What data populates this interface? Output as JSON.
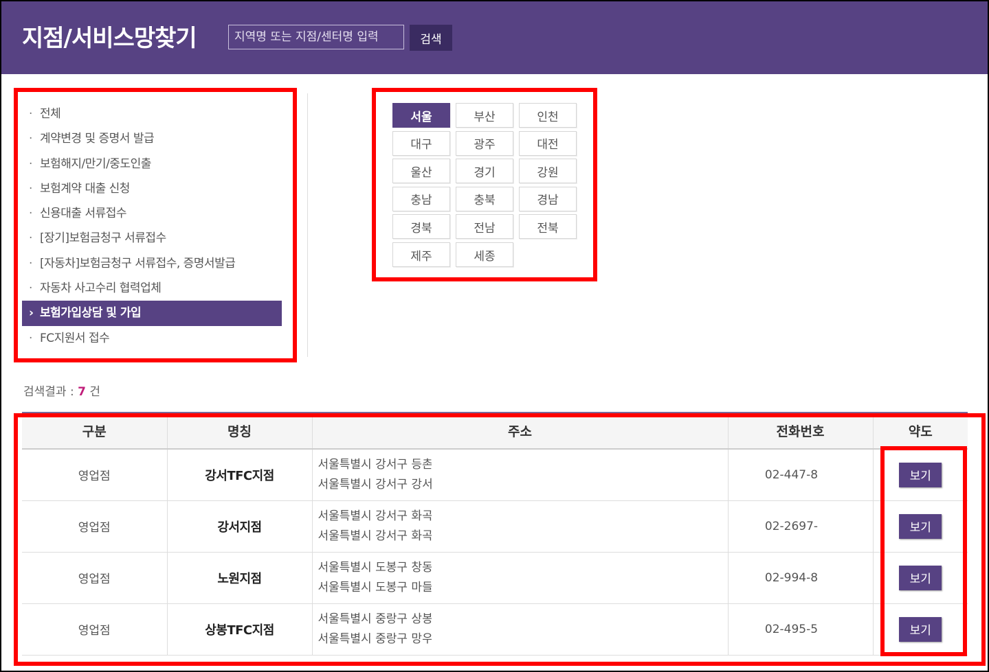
{
  "header": {
    "title": "지점/서비스망찾기",
    "search_placeholder": "지역명 또는 지점/센터명 입력",
    "search_button": "검색"
  },
  "categories": [
    {
      "label": "전체",
      "active": false
    },
    {
      "label": "계약변경 및 증명서 발급",
      "active": false
    },
    {
      "label": "보험해지/만기/중도인출",
      "active": false
    },
    {
      "label": "보험계약 대출 신청",
      "active": false
    },
    {
      "label": "신용대출 서류접수",
      "active": false
    },
    {
      "label": "[장기]보험금청구 서류접수",
      "active": false
    },
    {
      "label": "[자동차]보험금청구 서류접수, 증명서발급",
      "active": false
    },
    {
      "label": "자동차 사고수리 협력업체",
      "active": false
    },
    {
      "label": "보험가입상담 및 가입",
      "active": true
    },
    {
      "label": "FC지원서 접수",
      "active": false
    }
  ],
  "regions": [
    {
      "label": "서울",
      "active": true
    },
    {
      "label": "부산",
      "active": false
    },
    {
      "label": "인천",
      "active": false
    },
    {
      "label": "대구",
      "active": false
    },
    {
      "label": "광주",
      "active": false
    },
    {
      "label": "대전",
      "active": false
    },
    {
      "label": "울산",
      "active": false
    },
    {
      "label": "경기",
      "active": false
    },
    {
      "label": "강원",
      "active": false
    },
    {
      "label": "충남",
      "active": false
    },
    {
      "label": "충북",
      "active": false
    },
    {
      "label": "경남",
      "active": false
    },
    {
      "label": "경북",
      "active": false
    },
    {
      "label": "전남",
      "active": false
    },
    {
      "label": "전북",
      "active": false
    },
    {
      "label": "제주",
      "active": false
    },
    {
      "label": "세종",
      "active": false
    }
  ],
  "result": {
    "label": "검색결과 : ",
    "count": "7",
    "unit": " 건"
  },
  "table": {
    "headers": [
      "구분",
      "명칭",
      "주소",
      "전화번호",
      "약도"
    ],
    "rows": [
      {
        "type": "영업점",
        "name": "강서TFC지점",
        "addr1": "서울특별시 강서구 등촌",
        "addr2": "서울특별시 강서구 강서",
        "phone": "02-447-8",
        "map": "보기"
      },
      {
        "type": "영업점",
        "name": "강서지점",
        "addr1": "서울특별시 강서구 화곡",
        "addr2": "서울특별시 강서구 화곡",
        "phone": "02-2697-",
        "map": "보기"
      },
      {
        "type": "영업점",
        "name": "노원지점",
        "addr1": "서울특별시 도봉구 창동",
        "addr2": "서울특별시 도봉구 마들",
        "phone": "02-994-8",
        "map": "보기"
      },
      {
        "type": "영업점",
        "name": "상봉TFC지점",
        "addr1": "서울특별시 중랑구 상봉",
        "addr2": "서울특별시 중랑구 망우",
        "phone": "02-495-5",
        "map": "보기"
      }
    ]
  },
  "colors": {
    "brand": "#574283",
    "highlight": "#ff0000",
    "count_accent": "#c01e7a"
  }
}
